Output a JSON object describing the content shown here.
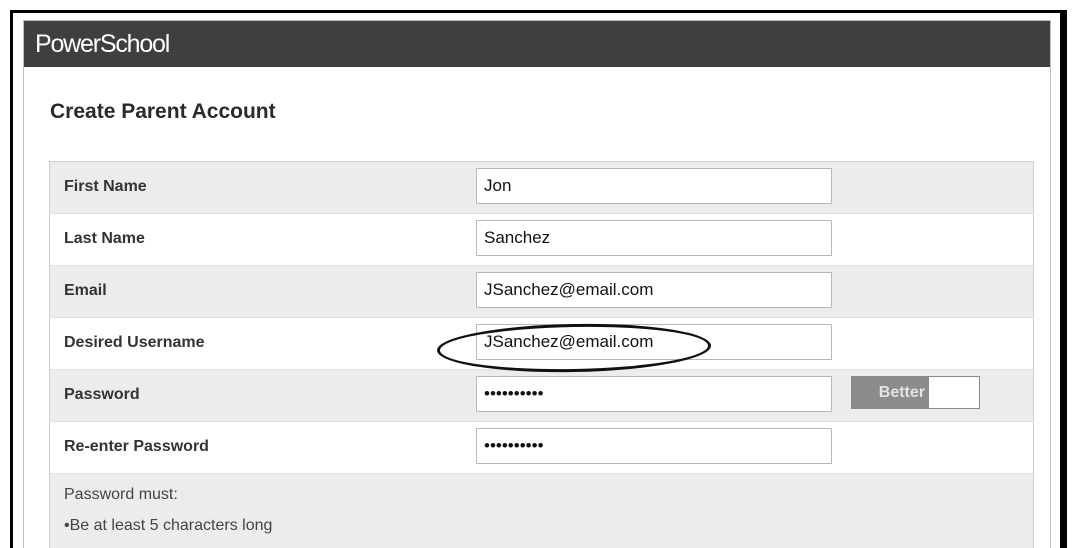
{
  "header": {
    "logo": "PowerSchool"
  },
  "page": {
    "title": "Create Parent Account"
  },
  "form": {
    "first_name": {
      "label": "First Name",
      "value": "Jon"
    },
    "last_name": {
      "label": "Last Name",
      "value": "Sanchez"
    },
    "email": {
      "label": "Email",
      "value": "JSanchez@email.com"
    },
    "username": {
      "label": "Desired Username",
      "value": "JSanchez@email.com"
    },
    "password": {
      "label": "Password",
      "value": "••••••••••",
      "strength_label": "Better",
      "strength_level": 0.6
    },
    "password_confirm": {
      "label": "Re-enter Password",
      "value": "••••••••••"
    }
  },
  "rules": {
    "title": "Password must:",
    "items": [
      "•Be at least 5 characters long"
    ]
  },
  "colors": {
    "topbar": "#3f3f3f",
    "row_shade": "#ececec",
    "strength_fill": "#8c8c8c"
  }
}
